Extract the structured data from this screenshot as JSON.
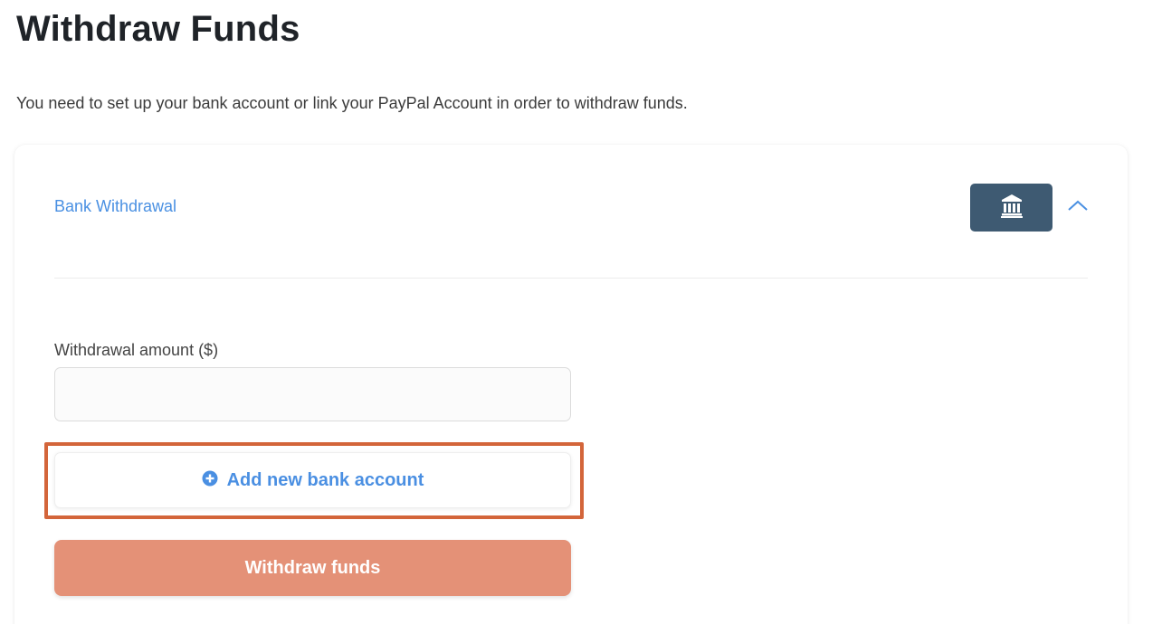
{
  "page": {
    "title": "Withdraw Funds",
    "intro": "You need to set up your bank account or link your PayPal Account in order to withdraw funds."
  },
  "bank_section": {
    "title": "Bank Withdrawal",
    "icon": "bank-icon",
    "toggle_icon": "chevron-up-icon",
    "expanded": true
  },
  "form": {
    "amount_label": "Withdrawal amount ($)",
    "amount_value": "",
    "add_bank_icon": "plus-circle-icon",
    "add_bank_label": "Add new bank account",
    "withdraw_label": "Withdraw funds"
  },
  "colors": {
    "link_blue": "#4a90e2",
    "bank_button": "#3e5a72",
    "withdraw_button": "#e49177",
    "highlight": "#d3653a"
  }
}
